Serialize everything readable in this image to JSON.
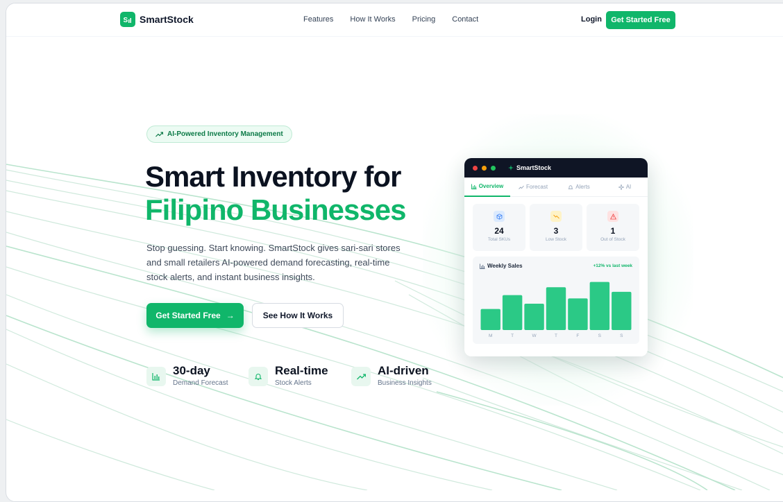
{
  "colors": {
    "brand": "#10b66a",
    "dark": "#0f1525",
    "text": "#0b1220"
  },
  "nav": {
    "logo_text": "SmartStock",
    "links": [
      "Features",
      "How It Works",
      "Pricing",
      "Contact"
    ],
    "login": "Login",
    "cta": "Get Started Free"
  },
  "hero": {
    "badge": "AI-Powered Inventory Management",
    "title_line1": "Smart Inventory for",
    "title_line2": "Filipino Businesses",
    "subtitle": "Stop guessing. Start knowing. SmartStock gives sari-sari stores and small retailers AI-powered demand forecasting, real-time stock alerts, and instant business insights.",
    "primary_cta": "Get Started Free",
    "primary_cta_arrow": "→",
    "secondary_cta": "See How It Works",
    "stats": [
      {
        "icon": "bar-chart-icon",
        "value": "30-day",
        "label": "Demand Forecast"
      },
      {
        "icon": "bell-icon",
        "value": "Real-time",
        "label": "Stock Alerts"
      },
      {
        "icon": "trend-up-icon",
        "value": "AI-driven",
        "label": "Business Insights"
      }
    ]
  },
  "dashboard": {
    "app_name": "SmartStock",
    "tabs": [
      "Overview",
      "Forecast",
      "Alerts",
      "AI"
    ],
    "active_tab": "Overview",
    "kpis": [
      {
        "icon": "box-icon",
        "value": "24",
        "label": "Total SKUs",
        "color": "#3b82f6"
      },
      {
        "icon": "trend-down-icon",
        "value": "3",
        "label": "Low Stock",
        "color": "#f59e0b"
      },
      {
        "icon": "warning-icon",
        "value": "1",
        "label": "Out of Stock",
        "color": "#ef4444"
      }
    ],
    "sales_title": "Weekly Sales",
    "sales_delta": "+12% vs last week"
  },
  "chart_data": {
    "type": "bar",
    "title": "Weekly Sales",
    "categories": [
      "M",
      "T",
      "W",
      "T",
      "F",
      "S",
      "S"
    ],
    "values": [
      32,
      53,
      40,
      65,
      48,
      73,
      58
    ],
    "ylim": [
      0,
      80
    ],
    "grid": false,
    "color": "#2bc986"
  }
}
